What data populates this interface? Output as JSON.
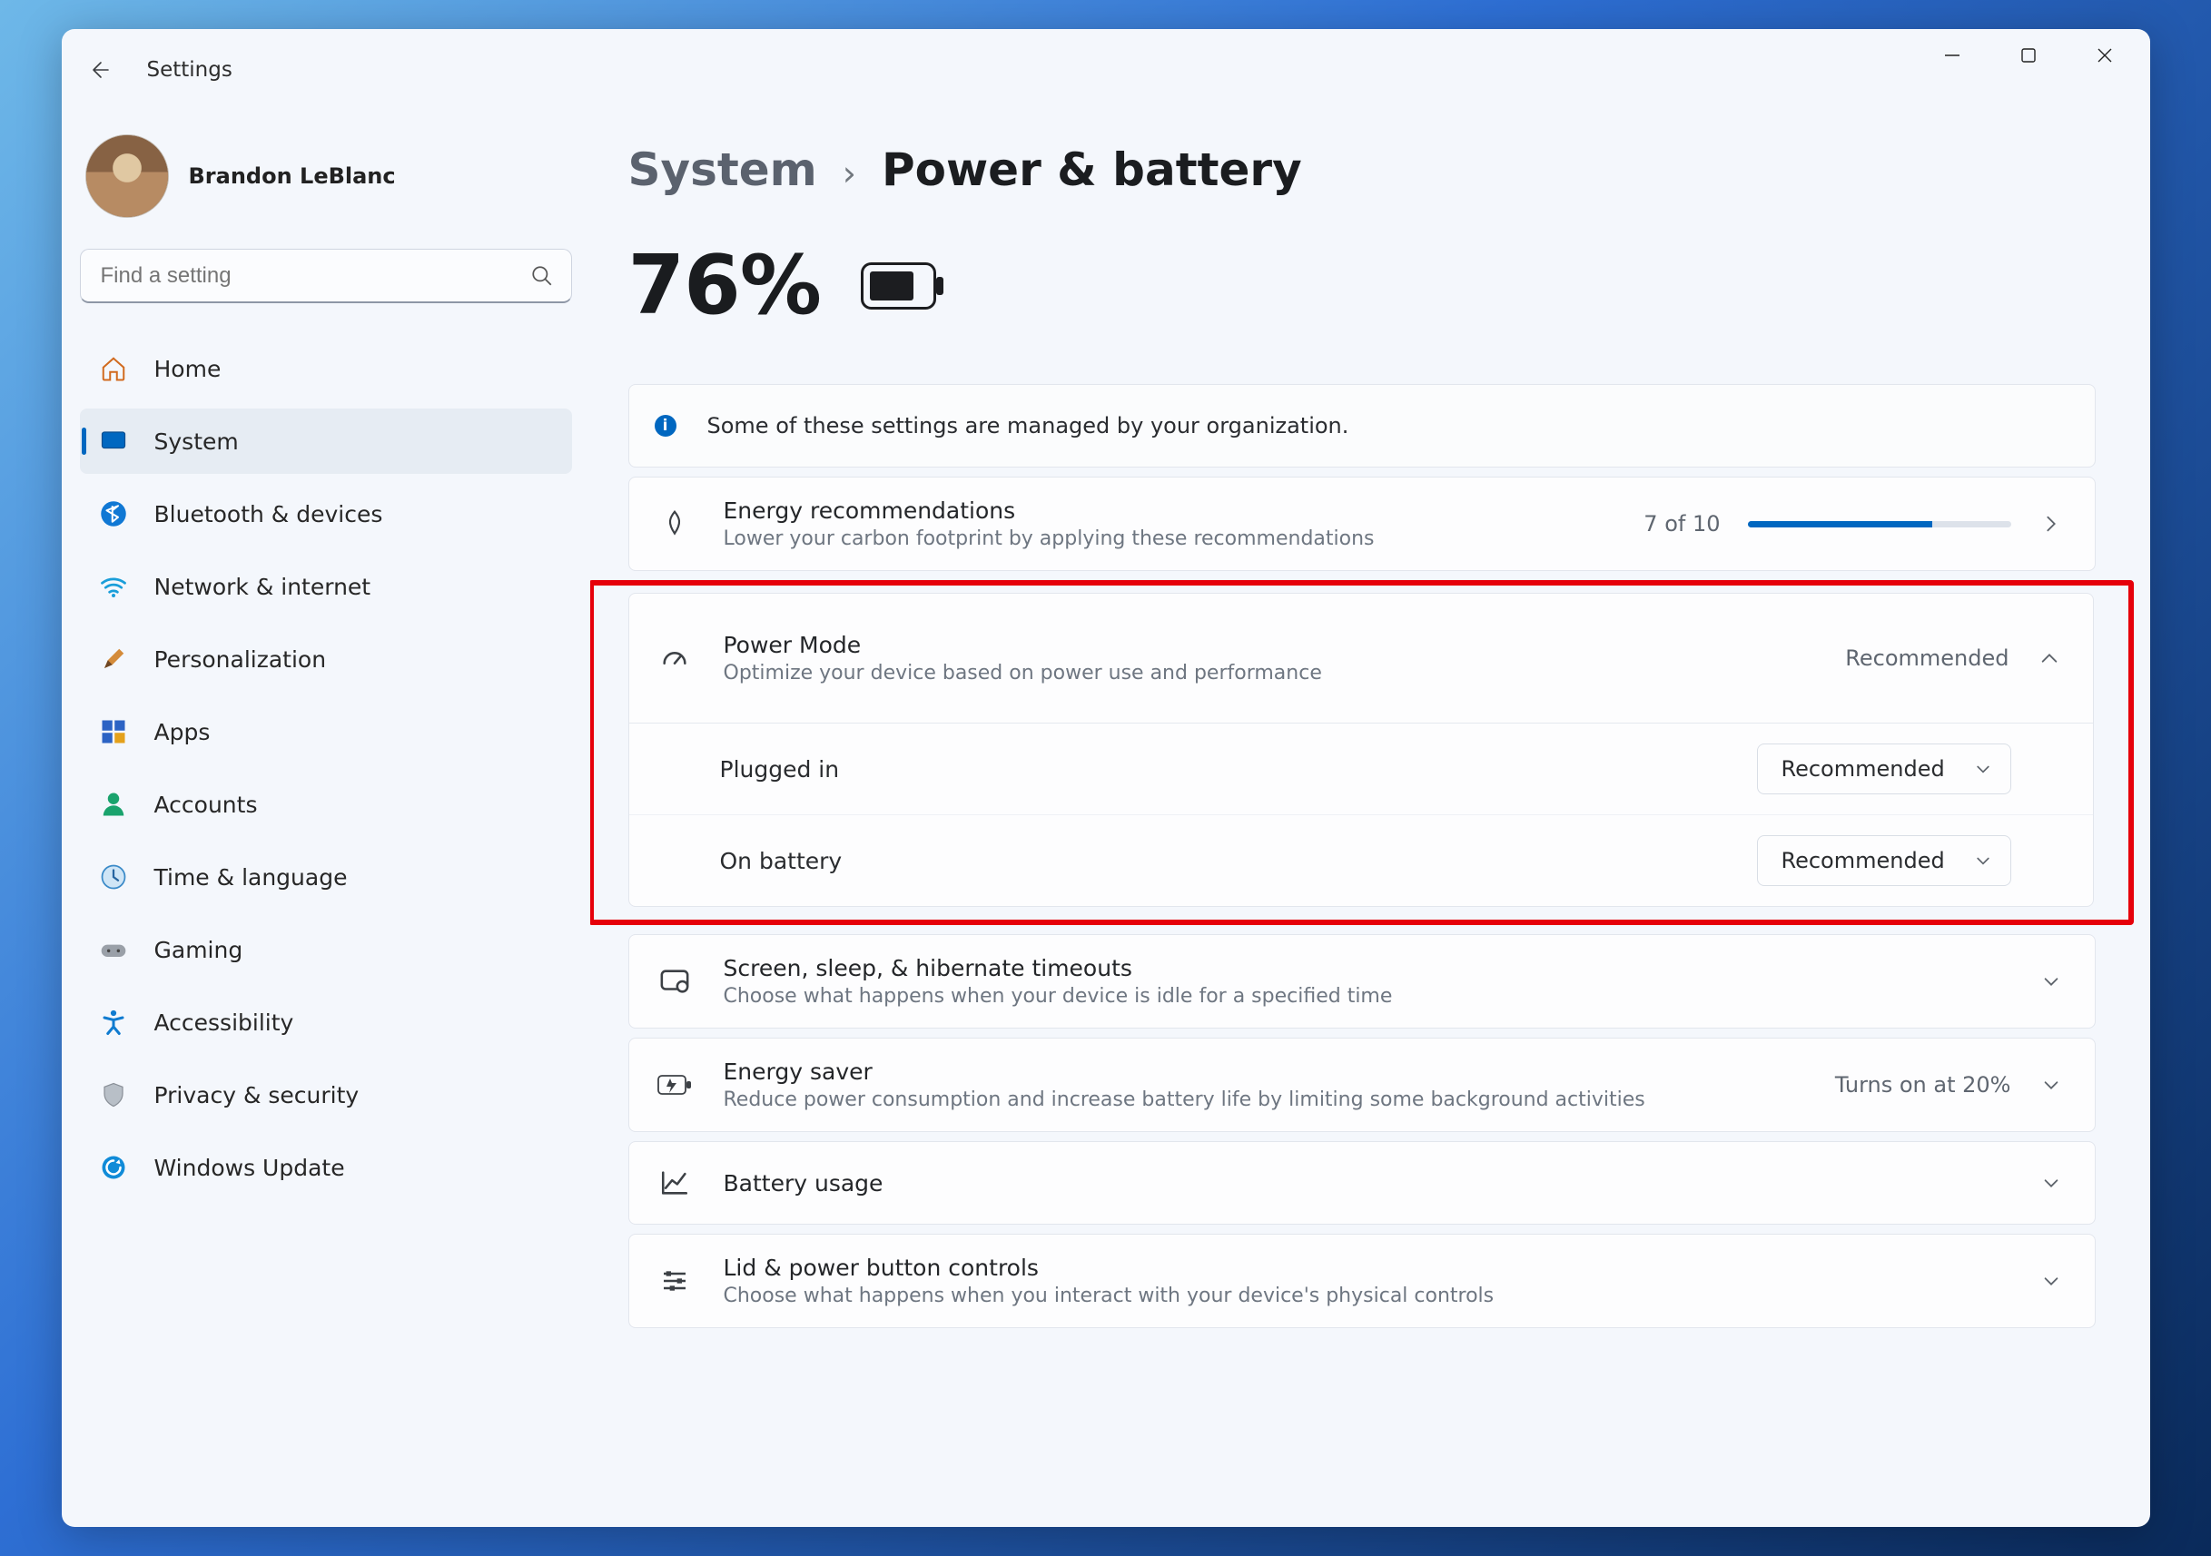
{
  "window": {
    "title": "Settings"
  },
  "user": {
    "name": "Brandon LeBlanc"
  },
  "search": {
    "placeholder": "Find a setting"
  },
  "nav": {
    "home": "Home",
    "system": "System",
    "bluetooth": "Bluetooth & devices",
    "network": "Network & internet",
    "personalization": "Personalization",
    "apps": "Apps",
    "accounts": "Accounts",
    "time": "Time & language",
    "gaming": "Gaming",
    "accessibility": "Accessibility",
    "privacy": "Privacy & security",
    "update": "Windows Update"
  },
  "breadcrumb": {
    "root": "System",
    "page": "Power & battery"
  },
  "battery": {
    "percent": "76%"
  },
  "info": {
    "text": "Some of these settings are managed by your organization."
  },
  "energy": {
    "title": "Energy recommendations",
    "desc": "Lower your carbon footprint by applying these recommendations",
    "score": "7 of 10"
  },
  "powermode": {
    "title": "Power Mode",
    "desc": "Optimize your device based on power use and performance",
    "summary": "Recommended",
    "plugged_label": "Plugged in",
    "plugged_value": "Recommended",
    "battery_label": "On battery",
    "battery_value": "Recommended"
  },
  "sleep": {
    "title": "Screen, sleep, & hibernate timeouts",
    "desc": "Choose what happens when your device is idle for a specified time"
  },
  "saver": {
    "title": "Energy saver",
    "desc": "Reduce power consumption and increase battery life by limiting some background activities",
    "summary": "Turns on at 20%"
  },
  "usage": {
    "title": "Battery usage"
  },
  "lid": {
    "title": "Lid & power button controls",
    "desc": "Choose what happens when you interact with your device's physical controls"
  }
}
